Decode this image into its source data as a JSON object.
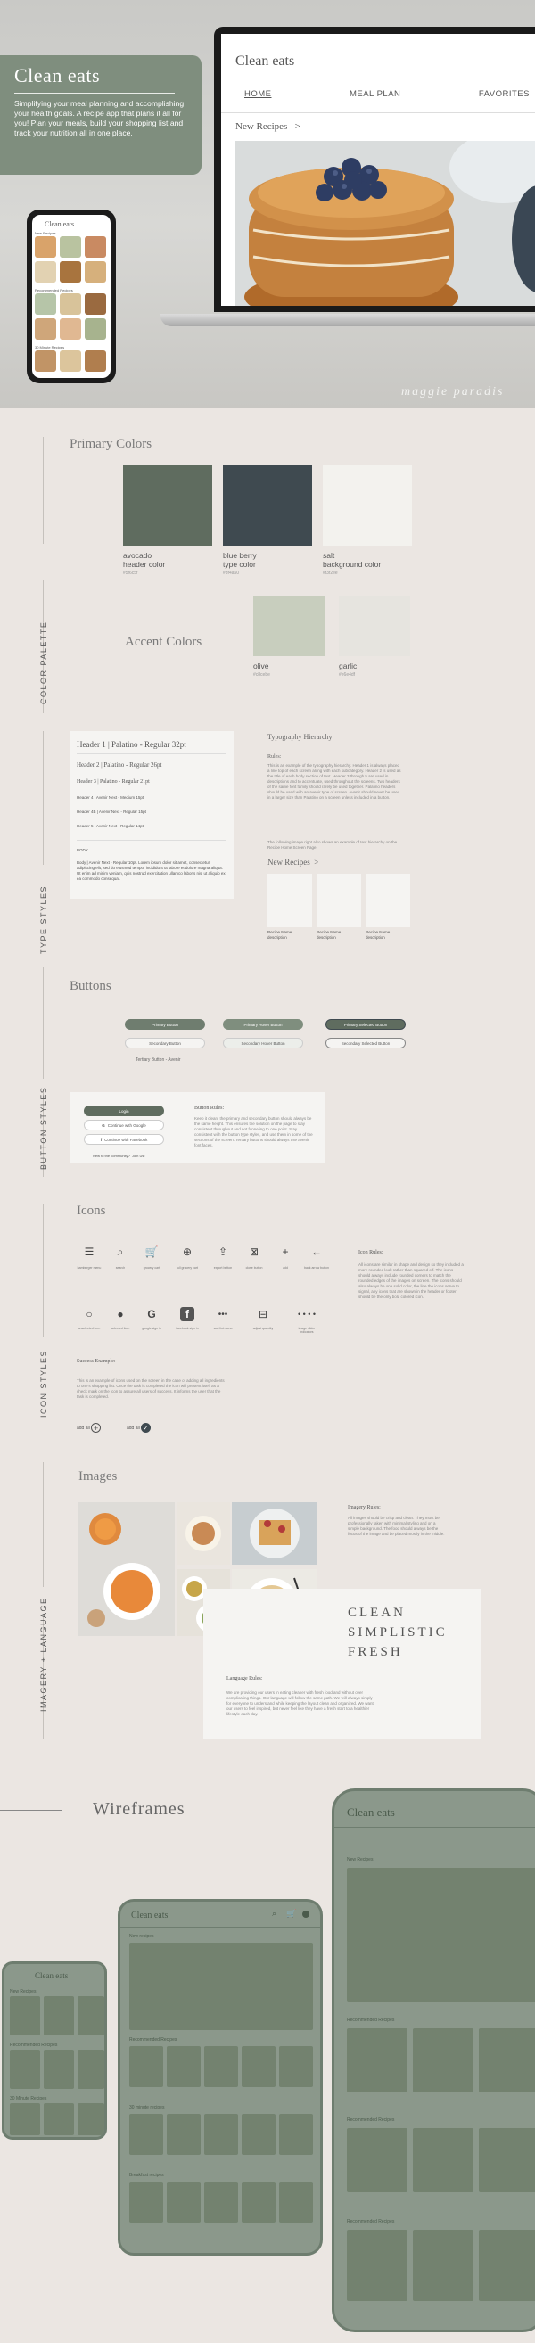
{
  "hero": {
    "title": "Clean eats",
    "tagline": "Simplifying your meal planning and accomplishing your health goals. A recipe app that plans it all for you! Plan your meals, build your shopping list and track your nutrition all in one place.",
    "signature": "maggie paradis"
  },
  "laptop": {
    "app_title": "Clean eats",
    "nav": [
      "HOME",
      "MEAL PLAN",
      "FAVORITES"
    ],
    "new_recipes": "New Recipes",
    "new_recipes_chevron": ">"
  },
  "phone": {
    "title": "Clean eats",
    "sec1": "New Recipes",
    "sec2": "Recommended Recipes",
    "sec3": "30 Minute Recipes"
  },
  "colors": {
    "section_label": "COLOR PALETTE",
    "primary_title": "Primary Colors",
    "accent_title": "Accent Colors",
    "primary": [
      {
        "name": "avocado",
        "role": "header color",
        "hex": "#5f6c5f"
      },
      {
        "name": "blue berry",
        "role": "type color",
        "hex": "#3f4a50"
      },
      {
        "name": "salt",
        "role": "background color",
        "hex": "#f3f2ee"
      }
    ],
    "accent": [
      {
        "name": "olive",
        "hex": "#c8cebe"
      },
      {
        "name": "garlic",
        "hex": "#e6e4df"
      }
    ]
  },
  "type": {
    "section_label": "TYPE STYLES",
    "h1": "Header 1 | Palatino - Regular 32pt",
    "h2": "Header 2 | Palatino - Regular 26pt",
    "h3": "Header 3 | Palatino - Regular 21pt",
    "h4": "Header 4 | Avenir Next - Medium 15pt",
    "h5": "Header 4B | Avenir Next - Regular 15pt",
    "h6": "Header 5 | Avenir Next - Regular 14pt",
    "body_label": "BODY",
    "body": "Body | Avenir Next - Regular 10pt. Lorem ipsum dolor sit amet, consectetur adipiscing elit, sed do eiusmod tempor incididunt ut labore et dolore magna aliqua. Ut enim ad minim veniam, quis nostrud exercitation ullamco laboris nisi ut aliquip ex ea commodo consequat.",
    "hierarchy_title": "Typography Hierarchy",
    "rules_title": "Rules:",
    "rules": "This is an example of the typography hierarchy. Header 1 is always placed a line top of each screen along with each subcategory. Header 2 is used as the title of each body section of text. Header 3 through 5 are used in descriptions and to accentuate, used throughout the screens. Two headers of the same font family should rarely be used together. Palatino headers should be used with an avenir type of screen. Avenir should never be used in a larger size than Palatino on a screen unless included in a button.",
    "following": "The following image right also shows an example of text hierarchy on the Recipe Home Screen Page.",
    "sample_title": "New Recipes",
    "sample_chevron": ">",
    "sample_cards": [
      {
        "name": "Recipe Name",
        "desc": "description"
      },
      {
        "name": "Recipe Name",
        "desc": "description"
      },
      {
        "name": "Recipe Name",
        "desc": "description"
      }
    ]
  },
  "buttons": {
    "section_label": "BUTTON STYLES",
    "title": "Buttons",
    "primary": [
      "Primary Button",
      "Primary Hover Button",
      "Primary Selected Button"
    ],
    "secondary": [
      "Secondary Button",
      "Secondary Hover Button",
      "Secondary Selected Button"
    ],
    "tertiary": "Tertiary Button - Avenir",
    "login": "Login",
    "google": "Continue with Google",
    "facebook": "Continue with Facebook",
    "new": "New to the community?",
    "join": "Join Us!",
    "rules_title": "Button Rules:",
    "rules": "Keep it clean: the primary and secondary button should always be the same height. This ensures the solution on the page to stay consistent throughout and not funneling to one point. Stay consistent with the button type styles, and use them in some of the sections of the screen. Tertiary buttons should always use avenir font faces."
  },
  "icons": {
    "section_label": "ICON STYLES",
    "title": "Icons",
    "row1": [
      {
        "glyph": "☰",
        "label": "hamburger menu"
      },
      {
        "glyph": "⌕",
        "label": "search"
      },
      {
        "glyph": "🛒",
        "label": "grocery cart"
      },
      {
        "glyph": "⊕",
        "label": "full grocery cart"
      },
      {
        "glyph": "⇪",
        "label": "export button"
      },
      {
        "glyph": "⊠",
        "label": "close button"
      },
      {
        "glyph": "+",
        "label": "add"
      },
      {
        "glyph": "←",
        "label": "back arrow button"
      }
    ],
    "row2": [
      {
        "glyph": "○",
        "label": "unselected item"
      },
      {
        "glyph": "●",
        "label": "selected item"
      },
      {
        "glyph": "G",
        "label": "google sign in"
      },
      {
        "glyph": "f",
        "label": "facebook sign in"
      },
      {
        "glyph": "•••",
        "label": "sort list menu"
      },
      {
        "glyph": "⊟",
        "label": "adjust quantity"
      },
      {
        "glyph": "• • • •",
        "label": "image slider indicators"
      }
    ],
    "rules_title": "Icon Rules:",
    "rules": "All icons are similar in shape and design so they included a more rounded look rather than squared off. The icons should always include rounded corners to match the rounded edges of the images on screen. The icons should also always be one solid color, the line the icons serve to signal, any icons that are shown in the header or footer should be the only bold colored icon.",
    "success_title": "Success Example:",
    "success": "This is an example of icons used on the screen in the case of adding all ingredients to one's shopping list. Once the task is completed the icon will present itself as a check mark on the icon to assure all users of success. It informs the user that the task is completed.",
    "add1": "add all",
    "add2": "add all"
  },
  "imagery": {
    "section_label": "IMAGERY + LANGUAGE",
    "title": "Images",
    "rules_title": "Imagery Rules:",
    "rules": "All images should be crisp and clean. They must be professionally taken with minimal styling and on a simple background. The food should always be the focus of the image and be placed mostly in the middle.",
    "words": [
      "CLEAN",
      "SIMPLISTIC",
      "FRESH"
    ],
    "lang_title": "Language Rules:",
    "lang": "We are providing our users in eating cleaner with fresh food and without over complicating things. Our language will follow the same path. We will always simply for everyone to understand while keeping the layout clean and organized. We want our users to feel inspired, but never feel like they have a fresh start to a healthier lifestyle each day."
  },
  "wireframes": {
    "title": "Wireframes",
    "small": {
      "title": "Clean eats",
      "s1": "New Recipes",
      "s2": "Recommended Recipes",
      "s3": "30 Minute Recipes"
    },
    "medium": {
      "title": "Clean eats",
      "s1": "New recipes",
      "s2": "Recommended Recipes",
      "s3": "30 minute recipes",
      "s4": "Breakfast recipes"
    },
    "large": {
      "title": "Clean eats",
      "s1": "New Recipes",
      "s2": "Recommended Recipes",
      "s3": "Recommended Recipes",
      "s4": "Recommended Recipes"
    }
  },
  "palette": {
    "sage": "#7f8e7e",
    "dark": "#5f6c5f",
    "panel": "#f5f4f2"
  }
}
